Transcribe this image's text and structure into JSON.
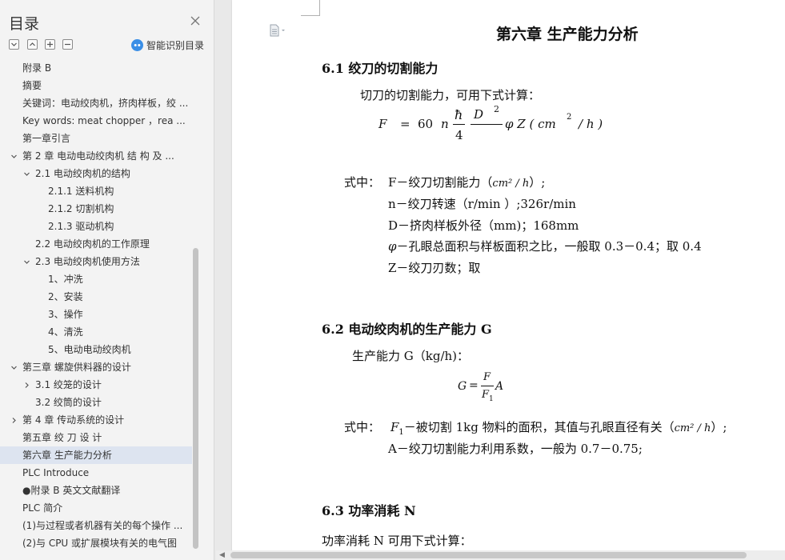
{
  "sidebar": {
    "title": "目录",
    "smart_label": "智能识别目录",
    "items": [
      {
        "label": "附录 B",
        "level": 1,
        "caret": ""
      },
      {
        "label": "摘要",
        "level": 1,
        "caret": ""
      },
      {
        "label": "关键词：电动绞肉机，挤肉样板，绞 ...",
        "level": 1,
        "caret": ""
      },
      {
        "label": "Key words: meat chopper ，rea ...",
        "level": 1,
        "caret": ""
      },
      {
        "label": "第一章引言",
        "level": 1,
        "caret": ""
      },
      {
        "label": "第 2 章   电动电动绞肉机  结 构  及 ...",
        "level": 1,
        "caret": "down"
      },
      {
        "label": "2.1 电动绞肉机的结构",
        "level": 2,
        "caret": "down"
      },
      {
        "label": "2.1.1 送料机构",
        "level": 3,
        "caret": ""
      },
      {
        "label": "2.1.2 切割机构",
        "level": 3,
        "caret": ""
      },
      {
        "label": "2.1.3 驱动机构",
        "level": 3,
        "caret": ""
      },
      {
        "label": "2.2 电动绞肉机的工作原理",
        "level": 2,
        "caret": ""
      },
      {
        "label": "2.3 电动绞肉机使用方法",
        "level": 2,
        "caret": "down"
      },
      {
        "label": "1、冲洗",
        "level": 3,
        "caret": ""
      },
      {
        "label": "2、安装",
        "level": 3,
        "caret": ""
      },
      {
        "label": "3、操作",
        "level": 3,
        "caret": ""
      },
      {
        "label": "4、清洗",
        "level": 3,
        "caret": ""
      },
      {
        "label": "5、电动电动绞肉机",
        "level": 3,
        "caret": ""
      },
      {
        "label": "第三章  螺旋供料器的设计",
        "level": 1,
        "caret": "down"
      },
      {
        "label": "3.1 绞笼的设计",
        "level": 2,
        "caret": "right"
      },
      {
        "label": "3.2 绞筒的设计",
        "level": 2,
        "caret": ""
      },
      {
        "label": "第 4 章  传动系统的设计",
        "level": 1,
        "caret": "right"
      },
      {
        "label": "第五章  绞  刀  设  计",
        "level": 1,
        "caret": ""
      },
      {
        "label": "第六章  生产能力分析",
        "level": 1,
        "caret": "",
        "selected": true
      },
      {
        "label": "PLC Introduce",
        "level": 1,
        "caret": ""
      },
      {
        "label": "●附录 B 英文文献翻译",
        "level": 1,
        "caret": ""
      },
      {
        "label": "PLC 简介",
        "level": 1,
        "caret": ""
      },
      {
        "label": "(1)与过程或者机器有关的每个操作 ...",
        "level": 1,
        "caret": ""
      },
      {
        "label": "(2)与 CPU 或扩展模块有关的电气图",
        "level": 1,
        "caret": ""
      }
    ]
  },
  "doc": {
    "chapter_title": "第六章  生产能力分析",
    "s61_title": "6.1 绞刀的切割能力",
    "s61_intro": "切刀的切割能力，可用下式计算：",
    "f1": {
      "lhs": "F",
      "eq": "=",
      "coef": "60",
      "n": "n",
      "hbar": "ħ",
      "four": "4",
      "D": "D",
      "sq": "2",
      "rest": "φ Z ( cm",
      "unit_sq": "2",
      "unit_tail": "/  h )"
    },
    "where1_prefix": "式中：",
    "where1_F": "F－绞刀切割能力（",
    "where1_F_unit": "cm² / h",
    "where1_F_close": "）;",
    "where1_n": "n－绞刀转速（r/min  ）;326r/min",
    "where1_D": "D－挤肉样板外径（mm)；168mm",
    "where1_phi_sym": "φ",
    "where1_phi": "－孔眼总面积与样板面积之比，一般取 0.3－0.4；取 0.4",
    "where1_Z": "Z－绞刀刃数；取",
    "s62_title": "6.2 电动绞肉机的生产能力 G",
    "s62_intro": "生产能力 G（kg/h)：",
    "f2": {
      "G": "G",
      "eq": "=",
      "F": "F",
      "F1": "F",
      "sub1": "1",
      "A": "A"
    },
    "where2_prefix": "式中：",
    "where2_F1_sym": "F",
    "where2_F1_sub": "1",
    "where2_F1": "－被切割 1kg 物料的面积，其值与孔眼直径有关（",
    "where2_F1_unit": "cm² / h",
    "where2_F1_close": "）;",
    "where2_A": "A－绞刀切割能力利用系数，一般为 0.7－0.75;",
    "s63_title": "6.3 功率消耗 N",
    "s63_intro": "功率消耗 N 可用下式计算："
  },
  "icons": {
    "close": "close-icon",
    "collapse": "collapse-all-icon",
    "expand_up": "chevron-up-icon",
    "add": "add-heading-icon",
    "remove": "remove-heading-icon",
    "smart": "ai-recognize-icon",
    "doc_menu": "document-menu-icon"
  },
  "colors": {
    "accent": "#3a8ee6",
    "selected_row": "#dde4f0",
    "sidebar_bg": "#f3f3f3"
  }
}
